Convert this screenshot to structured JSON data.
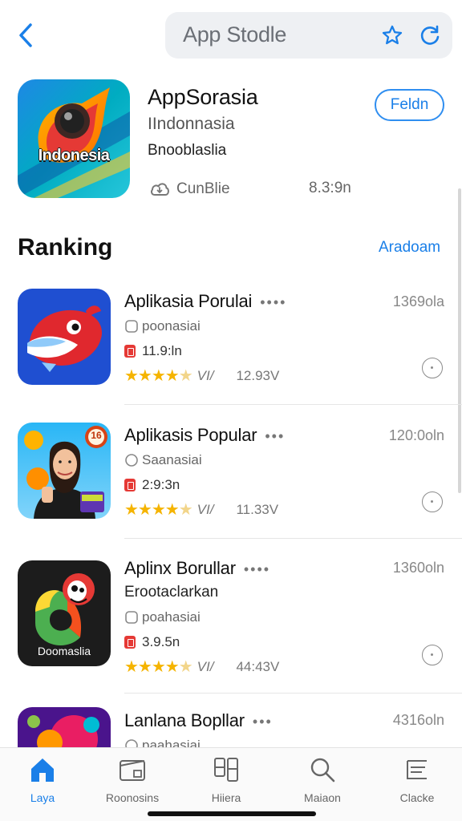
{
  "header": {
    "store_title": "App Stodle"
  },
  "featured": {
    "name": "AppSorasia",
    "icon_text": "Indonesia",
    "subtitle": "IIndonnasia",
    "subtitle2": "Bnooblaslia",
    "get_label": "Feldn",
    "meta_left": "CunBlie",
    "meta_right": "8.3:9n"
  },
  "section": {
    "title": "Ranking",
    "link": "Aradoam"
  },
  "rows": [
    {
      "title": "Aplikasia Porulai",
      "dots": "••••",
      "right": "1369ola",
      "line1": "poonasiai",
      "line2": "11.9:ln",
      "rating_word": "VI/",
      "count": "12.93V"
    },
    {
      "title": "Aplikasis Popular",
      "dots": "•••",
      "right": "120:0oln",
      "line1": "Saanasiai",
      "line2": "2:9:3n",
      "rating_word": "VI/",
      "count": "11.33V",
      "icon_badge": "16"
    },
    {
      "title": "Aplinx Borullar",
      "dots": "••••",
      "right": "1360oln",
      "line0": "Erootaclarkan",
      "line1": "poahasiai",
      "line2": "3.9.5n",
      "rating_word": "VI/",
      "count": "44:43V",
      "icon_text": "Doomaslia"
    },
    {
      "title": "Lanlana Bopllar",
      "dots": "•••",
      "right": "4316oln",
      "line1": "paahasiai"
    }
  ],
  "tabs": [
    {
      "label": "Laya"
    },
    {
      "label": "Roonosins"
    },
    {
      "label": "Hiiera"
    },
    {
      "label": "Maiaon"
    },
    {
      "label": "Clacke"
    }
  ],
  "colors": {
    "accent": "#1a7fe8",
    "star": "#f5b400",
    "search_bg": "#eef0f3"
  }
}
